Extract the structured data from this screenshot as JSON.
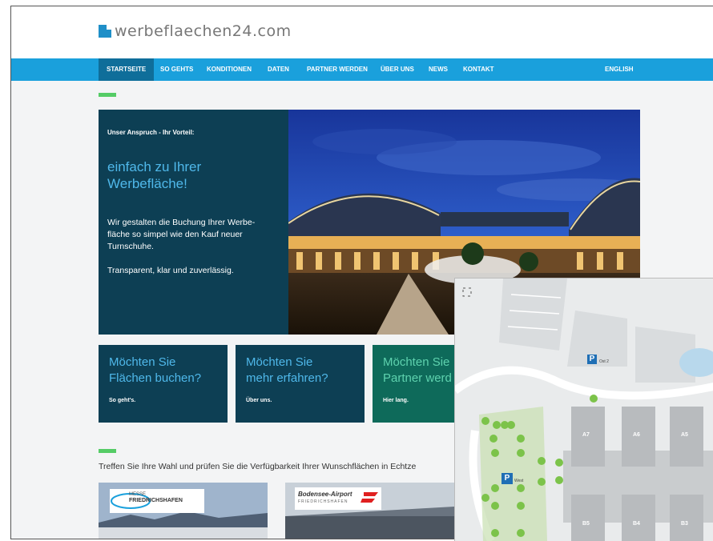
{
  "brand": {
    "name": "werbeflaechen24.com",
    "color": "#1f8fc8"
  },
  "nav": {
    "items": [
      {
        "label": "STARTSEITE",
        "active": true
      },
      {
        "label": "SO GEHTS"
      },
      {
        "label": "KONDITIONEN"
      },
      {
        "label": "DATEN"
      },
      {
        "label": "PARTNER WERDEN"
      },
      {
        "label": "ÜBER UNS"
      },
      {
        "label": "NEWS"
      },
      {
        "label": "KONTAKT"
      }
    ],
    "language": "ENGLISH",
    "bg_color": "#1aa0dc"
  },
  "hero": {
    "kicker": "Unser Anspruch - Ihr Vorteil:",
    "headline_line1": "einfach zu Ihrer",
    "headline_line2": "Werbefläche!",
    "body_line1": "Wir gestalten die Buchung Ihrer Werbe-",
    "body_line2": "fläche so simpel wie den Kauf neuer",
    "body_line3": "Turnschuhe.",
    "tagline": "Transparent, klar und zuverlässig."
  },
  "cards": [
    {
      "title_line1": "Möchten Sie",
      "title_line2": "Flächen buchen?",
      "link": "So geht's."
    },
    {
      "title_line1": "Möchten Sie",
      "title_line2": "mehr erfahren?",
      "link": "Über uns."
    },
    {
      "title_line1": "Möchten Sie",
      "title_line2": "Partner werd",
      "link": "Hier lang."
    }
  ],
  "selection": {
    "text": "Treffen Sie Ihre Wahl und prüfen Sie die Verfügbarkeit Ihrer Wunschflächen in Echtze"
  },
  "venues": [
    {
      "logo_line1": "MESSE",
      "logo_line2": "FRIEDRICHSHAFEN"
    },
    {
      "logo_line1": "Bodensee-Airport",
      "logo_line2": "FRIEDRICHSHAFEN"
    }
  ],
  "map": {
    "parking_label": "P",
    "parking_labels": [
      "Ost 2",
      "West"
    ],
    "halls_top": [
      "A7",
      "A6",
      "A5"
    ],
    "halls_bottom": [
      "B5",
      "B4",
      "B3"
    ],
    "pin_color": "#7cc34a"
  }
}
